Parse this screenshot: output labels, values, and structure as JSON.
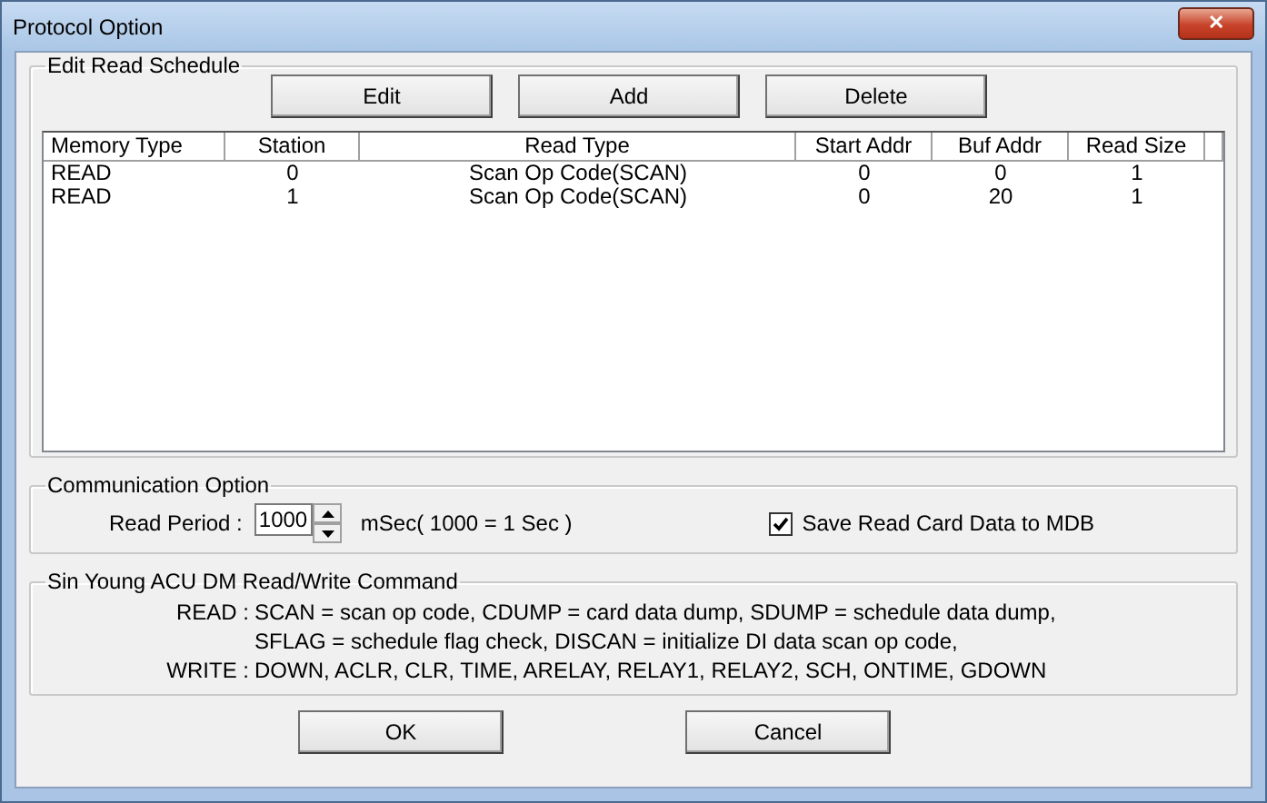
{
  "window": {
    "title": "Protocol Option",
    "close": "✕"
  },
  "schedule": {
    "title": "Edit Read Schedule",
    "buttons": [
      "Edit",
      "Add",
      "Delete"
    ],
    "columns": [
      "Memory Type",
      "Station",
      "Read Type",
      "Start Addr",
      "Buf Addr",
      "Read Size"
    ],
    "rows": [
      {
        "cells": [
          "READ",
          "0",
          "Scan Op Code(SCAN)",
          "0",
          "0",
          "1"
        ],
        "selected": false
      },
      {
        "cells": [
          "READ",
          "1",
          "Scan Op Code(SCAN)",
          "0",
          "20",
          "1"
        ],
        "selected": false
      }
    ]
  },
  "communication": {
    "title": "Communication Option",
    "period_label": "Read Period :",
    "period_value": "1000",
    "period_unit": "mSec( 1000 = 1 Sec )",
    "save_label": "Save Read Card Data to MDB",
    "save_checked": true
  },
  "commands": {
    "title": "Sin Young ACU DM Read/Write Command",
    "lines": [
      {
        "label": "READ :",
        "text": "SCAN = scan op code, CDUMP = card data dump, SDUMP = schedule data dump,"
      },
      {
        "text": "SFLAG = schedule flag check, DISCAN = initialize DI data scan op code,"
      },
      {
        "label": "WRITE :",
        "text": "DOWN, ACLR, CLR, TIME, ARELAY, RELAY1, RELAY2, SCH, ONTIME, GDOWN"
      }
    ]
  },
  "buttons": [
    "OK",
    "Cancel"
  ]
}
